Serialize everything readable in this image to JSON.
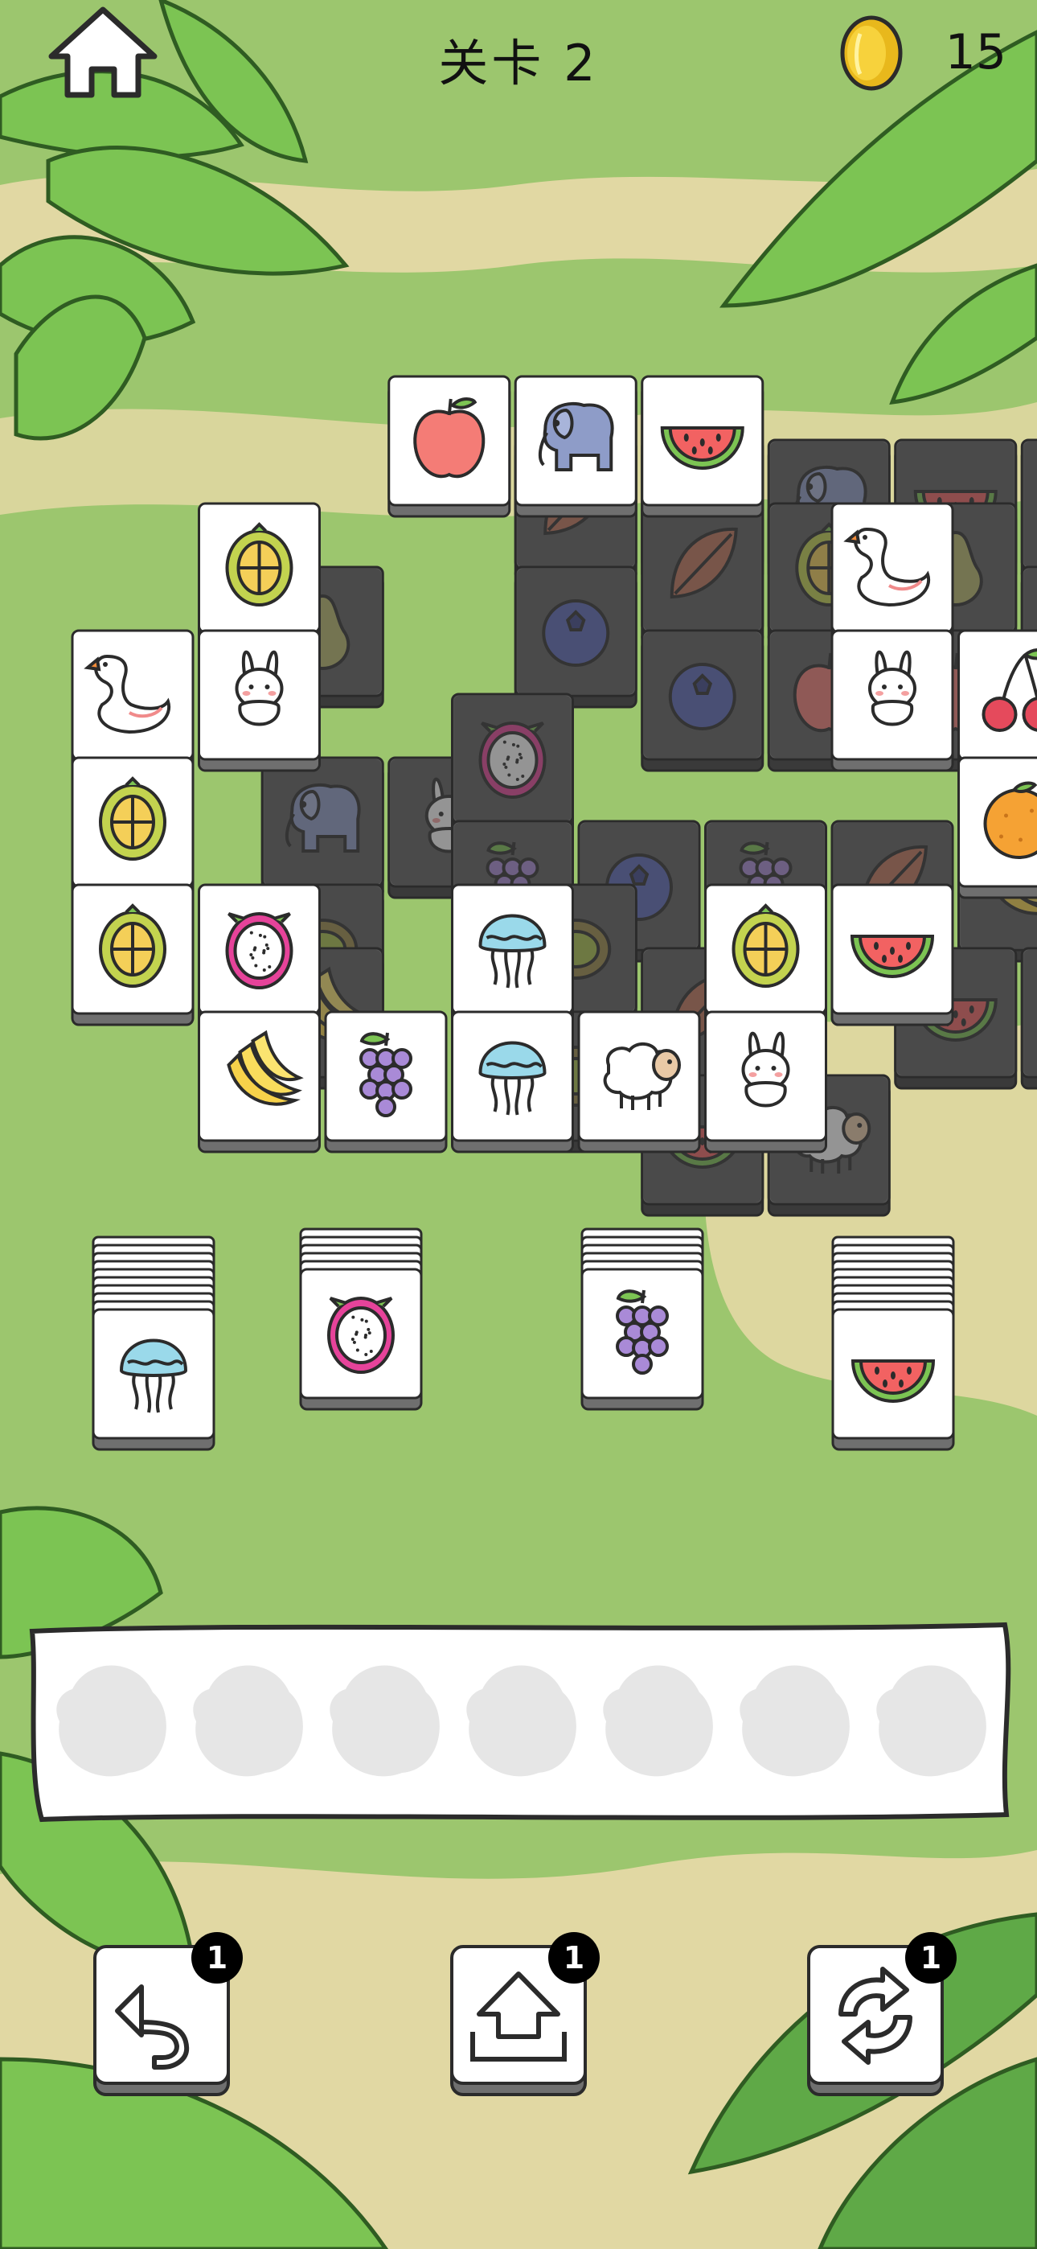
{
  "hud": {
    "level_label": "关卡 2",
    "coins": "15",
    "home_icon": "home-icon",
    "coin_icon": "coin-icon"
  },
  "tray": {
    "slot_count": 7,
    "filled": 0
  },
  "toolbar": {
    "undo": {
      "icon": "undo-icon",
      "count": "1"
    },
    "remove": {
      "icon": "eject-tray-icon",
      "count": "1"
    },
    "shuffle": {
      "icon": "shuffle-icon",
      "count": "1"
    }
  },
  "colors": {
    "background": "#9cc66e",
    "tile_face": "#ffffff",
    "tile_covered": "#5b5b5b",
    "tray": "#ffffff",
    "badge": "#000000"
  },
  "board": {
    "covered_tiles": [
      {
        "c": 3.5,
        "r": 0.5,
        "icon": "dragon-fruit-leaf"
      },
      {
        "c": 4.5,
        "r": 0.5,
        "icon": "blueberry"
      },
      {
        "c": 5.5,
        "r": 0.5,
        "icon": "elephant"
      },
      {
        "c": 6.5,
        "r": 0.5,
        "icon": "watermelon"
      },
      {
        "c": 7.5,
        "r": 0.5,
        "icon": "watermelon"
      },
      {
        "c": 1.5,
        "r": 1.5,
        "icon": "pear"
      },
      {
        "c": 3.5,
        "r": 1.5,
        "icon": "blueberry"
      },
      {
        "c": 4.5,
        "r": 1,
        "icon": "leaf"
      },
      {
        "c": 5.5,
        "r": 1,
        "icon": "durian"
      },
      {
        "c": 6.5,
        "r": 1,
        "icon": "pear"
      },
      {
        "c": 7.5,
        "r": 1.5,
        "icon": "banana"
      },
      {
        "c": 8.5,
        "r": 1.5,
        "icon": "cherry"
      },
      {
        "c": 4.5,
        "r": 2,
        "icon": "blueberry"
      },
      {
        "c": 5.5,
        "r": 2,
        "icon": "apple"
      },
      {
        "c": 6.5,
        "r": 2,
        "icon": "apple"
      },
      {
        "c": 1.5,
        "r": 3,
        "icon": "elephant"
      },
      {
        "c": 2.5,
        "r": 3,
        "icon": "rabbit"
      },
      {
        "c": 3,
        "r": 2.5,
        "icon": "dragon-fruit"
      },
      {
        "c": 7,
        "r": 2.5,
        "icon": "jellyfish"
      },
      {
        "c": 7.5,
        "r": 3,
        "icon": "elephant"
      },
      {
        "c": 8.5,
        "r": 3,
        "icon": "leaf"
      },
      {
        "c": 1.5,
        "r": 4,
        "icon": "kiwi"
      },
      {
        "c": 3,
        "r": 3.5,
        "icon": "grape"
      },
      {
        "c": 4,
        "r": 3.5,
        "icon": "blueberry"
      },
      {
        "c": 5,
        "r": 3.5,
        "icon": "grape"
      },
      {
        "c": 6,
        "r": 3.5,
        "icon": "leaf"
      },
      {
        "c": 7,
        "r": 3.5,
        "icon": "banana"
      },
      {
        "c": 8.5,
        "r": 4,
        "icon": "elephant"
      },
      {
        "c": 1.5,
        "r": 4.5,
        "icon": "banana"
      },
      {
        "c": 3.5,
        "r": 4,
        "icon": "kiwi"
      },
      {
        "c": 4.5,
        "r": 4.5,
        "icon": "leaf"
      },
      {
        "c": 6,
        "r": 4,
        "icon": "elephant"
      },
      {
        "c": 6.5,
        "r": 4.5,
        "icon": "watermelon"
      },
      {
        "c": 7.5,
        "r": 4.5,
        "icon": "leaf"
      },
      {
        "c": 8.5,
        "r": 4.5,
        "icon": "leaf"
      },
      {
        "c": 3.5,
        "r": 5,
        "icon": "kiwi"
      },
      {
        "c": 4.5,
        "r": 5.5,
        "icon": "watermelon"
      },
      {
        "c": 5.5,
        "r": 5.5,
        "icon": "sheep"
      }
    ],
    "open_tiles": [
      {
        "c": 2.5,
        "r": 0,
        "icon": "apple"
      },
      {
        "c": 3.5,
        "r": 0,
        "icon": "elephant"
      },
      {
        "c": 4.5,
        "r": 0,
        "icon": "watermelon"
      },
      {
        "c": 1,
        "r": 1,
        "icon": "durian"
      },
      {
        "c": 6,
        "r": 1,
        "icon": "swan"
      },
      {
        "c": 0,
        "r": 2,
        "icon": "swan"
      },
      {
        "c": 1,
        "r": 2,
        "icon": "rabbit"
      },
      {
        "c": 6,
        "r": 2,
        "icon": "rabbit"
      },
      {
        "c": 7,
        "r": 2,
        "icon": "cherry"
      },
      {
        "c": 0,
        "r": 3,
        "icon": "durian"
      },
      {
        "c": 7,
        "r": 3,
        "icon": "orange"
      },
      {
        "c": 0,
        "r": 4,
        "icon": "durian"
      },
      {
        "c": 1,
        "r": 4,
        "icon": "dragon-fruit"
      },
      {
        "c": 3,
        "r": 4,
        "icon": "jellyfish"
      },
      {
        "c": 5,
        "r": 4,
        "icon": "durian"
      },
      {
        "c": 6,
        "r": 4,
        "icon": "watermelon"
      },
      {
        "c": 1,
        "r": 5,
        "icon": "banana"
      },
      {
        "c": 2,
        "r": 5,
        "icon": "grape"
      },
      {
        "c": 3,
        "r": 5,
        "icon": "jellyfish"
      },
      {
        "c": 4,
        "r": 5,
        "icon": "sheep"
      },
      {
        "c": 5,
        "r": 5,
        "icon": "rabbit"
      }
    ]
  },
  "stacks": [
    {
      "icon": "jellyfish",
      "depth": 9
    },
    {
      "icon": "dragon-fruit",
      "depth": 5
    },
    {
      "icon": "grape",
      "depth": 5
    },
    {
      "icon": "watermelon",
      "depth": 9
    }
  ]
}
